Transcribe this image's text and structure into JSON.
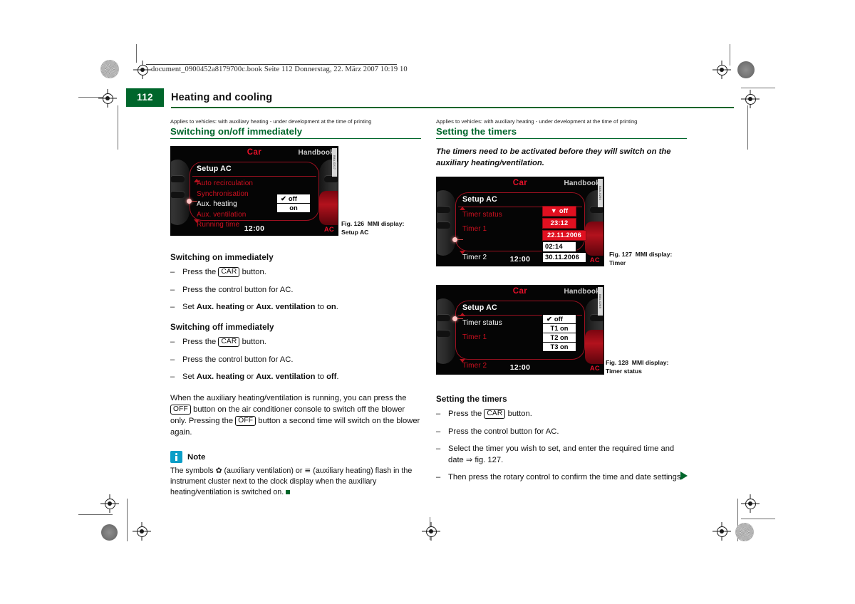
{
  "page": {
    "running_head": "document_0900452a8179700c.book  Seite 112  Donnerstag, 22. März 2007  10:19 10",
    "page_number": "112",
    "chapter_title": "Heating and cooling",
    "accent_green": "#00662b",
    "mmi_red": "#e8102a"
  },
  "left_column": {
    "applies_note": "Applies to vehicles: with auxiliary heating - under development at the time of printing",
    "section_title": "Switching on/off immediately",
    "figure": {
      "caption_label": "Fig. 126",
      "caption_text": "MMI display:",
      "caption_text2": "Setup AC",
      "side_code": "B8A-0217",
      "screen": {
        "brand": "Car",
        "handbook": "Handbook",
        "title": "Setup AC",
        "clock": "12:00",
        "status": "AC",
        "menu_items": [
          {
            "label": "Auto recirculation",
            "active": false
          },
          {
            "label": "Synchronisation",
            "active": false
          },
          {
            "label": "Aux. heating",
            "active": true
          },
          {
            "label": "Aux. ventilation",
            "active": false
          },
          {
            "label": "Running time",
            "active": false
          }
        ],
        "popup_options": [
          {
            "label": "off",
            "checked": true
          },
          {
            "label": "on",
            "checked": false
          }
        ]
      }
    },
    "sub1_title": "Switching on immediately",
    "sub1_steps": [
      {
        "pre": "Press the ",
        "kbd": "CAR",
        "post": " button."
      },
      {
        "pre": "Press the control button for AC.",
        "kbd": "",
        "post": ""
      },
      {
        "pre": "Set ",
        "kbd": "",
        "post": ""
      }
    ],
    "sub1_step3": {
      "p1": "Set ",
      "b1": "Aux. heating",
      "p2": " or ",
      "b2": "Aux. ventilation",
      "p3": " to ",
      "b3": "on",
      "p4": "."
    },
    "sub2_title": "Switching off immediately",
    "sub2_step3": {
      "p1": "Set ",
      "b1": "Aux. heating",
      "p2": " or ",
      "b2": "Aux. ventilation",
      "p3": " to ",
      "b3": "off",
      "p4": "."
    },
    "paragraph": {
      "t1": "When the auxiliary heating/ventilation is running, you can press the ",
      "kbd1": "OFF",
      "t2": " button on the air conditioner console to switch off the blower only. Pressing the ",
      "kbd2": "OFF",
      "t3": " button a second time will switch on the blower again."
    },
    "note": {
      "icon": "info-icon",
      "title": "Note",
      "t1": "The symbols ",
      "sym1": "✿",
      "t2": " (auxiliary ventilation) or ",
      "sym2": "≡",
      "t3": " (auxiliary heating) flash in the instrument cluster next to the clock display when the auxiliary heating/ventilation is switched on."
    },
    "steps_common": {
      "press_car_pre": "Press the ",
      "press_car_kbd": "CAR",
      "press_car_post": " button.",
      "press_control": "Press the control button for AC."
    }
  },
  "right_column": {
    "applies_note": "Applies to vehicles: with auxiliary heating - under development at the time of printing",
    "section_title": "Setting the timers",
    "lead": "The timers need to be activated before they will switch on the auxiliary heating/ventilation.",
    "figure127": {
      "caption_label": "Fig. 127",
      "caption_text": "MMI display:",
      "caption_text2": "Timer",
      "side_code": "B8A-0290",
      "screen": {
        "brand": "Car",
        "handbook": "Handbook",
        "title": "Setup AC",
        "clock": "12:00",
        "status": "AC",
        "menu_items": [
          {
            "label": "Timer status",
            "active": false
          },
          {
            "label": "Timer 1",
            "active": false
          },
          {
            "label": "Timer 2",
            "active": true
          }
        ],
        "values": [
          {
            "text": "off",
            "style": "red",
            "dropdown": true
          },
          {
            "text": "23:12",
            "style": "red",
            "dropdown": false
          },
          {
            "text": "22.11.2006",
            "style": "red",
            "dropdown": false
          },
          {
            "text": "02:14",
            "style": "white",
            "dropdown": false
          },
          {
            "text": "30.11.2006",
            "style": "white",
            "dropdown": false
          }
        ]
      }
    },
    "figure128": {
      "caption_label": "Fig. 128",
      "caption_text": "MMI display:",
      "caption_text2": "Timer status",
      "side_code": "B8A-0289",
      "screen": {
        "brand": "Car",
        "handbook": "Handbook",
        "title": "Setup AC",
        "clock": "12:00",
        "status": "AC",
        "menu_items": [
          {
            "label": "Timer status",
            "active": true
          },
          {
            "label": "Timer 1",
            "active": false
          },
          {
            "label": "Timer 2",
            "active": false
          }
        ],
        "popup_options": [
          {
            "label": "off",
            "checked": true
          },
          {
            "label": "T1 on",
            "checked": false
          },
          {
            "label": "T2 on",
            "checked": false
          },
          {
            "label": "T3 on",
            "checked": false
          }
        ]
      }
    },
    "sub_title": "Setting the timers",
    "step1": {
      "pre": "Press the ",
      "kbd": "CAR",
      "post": " button."
    },
    "step2": "Press the control button for AC.",
    "step3": "Select the timer you wish to set, and enter the required time and date ⇒ fig. 127.",
    "step4": "Then press the rotary control to confirm the time and date settings."
  }
}
